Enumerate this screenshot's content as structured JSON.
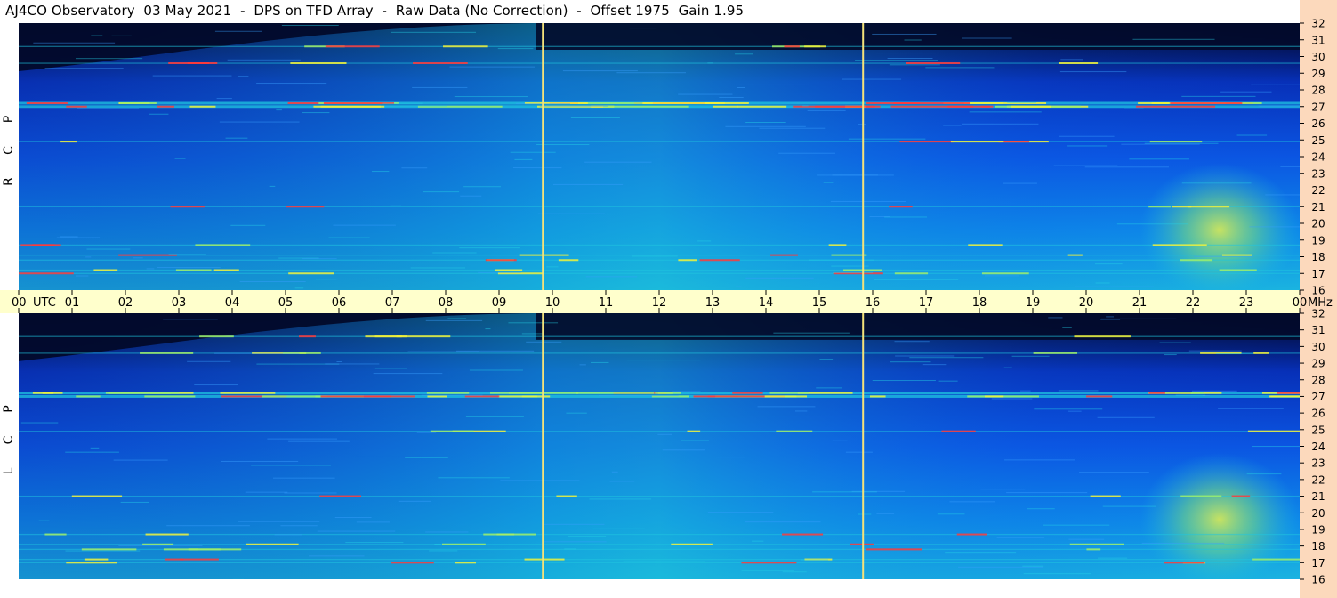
{
  "title": "AJ4CO Observatory  03 May 2021  -  DPS on TFD Array  -  Raw Data (No Correction)  -  Offset 1975  Gain 1.95",
  "colors": {
    "band": "#ffffcc",
    "freq_scale": "#fcd9bc",
    "marker_line": "#f4e27a",
    "background_dark": "#020a2a",
    "background_blue": "#0a3fd6",
    "noise_cyan": "#1fc6e0",
    "hot_yellow": "#f2f23a",
    "hot_red": "#ff3a3a"
  },
  "chart_data": {
    "type": "heatmap",
    "time_axis": {
      "unit_label": "UTC",
      "tick_labels": [
        "00",
        "01",
        "02",
        "03",
        "04",
        "05",
        "06",
        "07",
        "08",
        "09",
        "10",
        "11",
        "12",
        "13",
        "14",
        "15",
        "16",
        "17",
        "18",
        "19",
        "20",
        "21",
        "22",
        "23",
        "00"
      ],
      "range_hours": [
        0,
        24
      ]
    },
    "frequency_axis": {
      "unit_label": "MHz",
      "tick_labels": [
        "32",
        "31",
        "30",
        "29",
        "28",
        "27",
        "26",
        "25",
        "24",
        "23",
        "22",
        "21",
        "20",
        "19",
        "18",
        "17",
        "16"
      ],
      "range_mhz": [
        16,
        32
      ]
    },
    "panels": [
      {
        "label": "R C P",
        "letters": [
          "P",
          "C",
          "R"
        ]
      },
      {
        "label": "L C P",
        "letters": [
          "P",
          "C",
          "L"
        ]
      }
    ],
    "vertical_markers_utc_hours": [
      9.82,
      15.82
    ],
    "persistent_signal_bands_mhz": [
      17.0,
      17.2,
      17.8,
      18.1,
      18.7,
      21.0,
      24.9,
      27.0,
      27.2,
      29.6,
      30.6
    ],
    "storm_regions": [
      {
        "start_utc": 21.0,
        "end_utc": 24.0,
        "freq_min_mhz": 16,
        "freq_max_mhz": 24
      }
    ],
    "daylight_absorption_cutoff": {
      "start_utc": 0,
      "end_utc": 9.7
    }
  }
}
